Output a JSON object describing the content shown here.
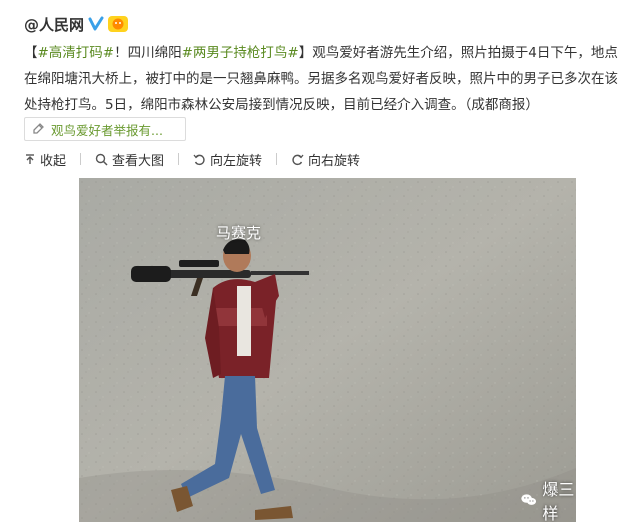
{
  "post": {
    "author": "@人民网",
    "verified_icon": "verified-v-icon",
    "text_open_bracket": "【",
    "tag1": "#高清打码#",
    "text1": "！四川绵阳",
    "tag2": "#两男子持枪打鸟#",
    "text2": "】观鸟爱好者游先生介绍，照片拍摄于4日下午，地点在绵阳塘汛大桥上，被打中的是一只翘鼻麻鸭。另据多名观鸟爱好者反映，照片中的男子已多次在该处持枪打鸟。5日，绵阳市森林公安局接到情况反映，目前已经介入调查。（成都商报）",
    "link_card_label": "观鸟爱好者举报有..."
  },
  "actions": {
    "collapse": "收起",
    "view_large": "查看大图",
    "rotate_left": "向左旋转",
    "rotate_right": "向右旋转"
  },
  "photo": {
    "caption": "马赛克",
    "watermark": "爆三样"
  },
  "colors": {
    "tag_green": "#5a8a20",
    "verified_blue": "#3aa0e8"
  }
}
